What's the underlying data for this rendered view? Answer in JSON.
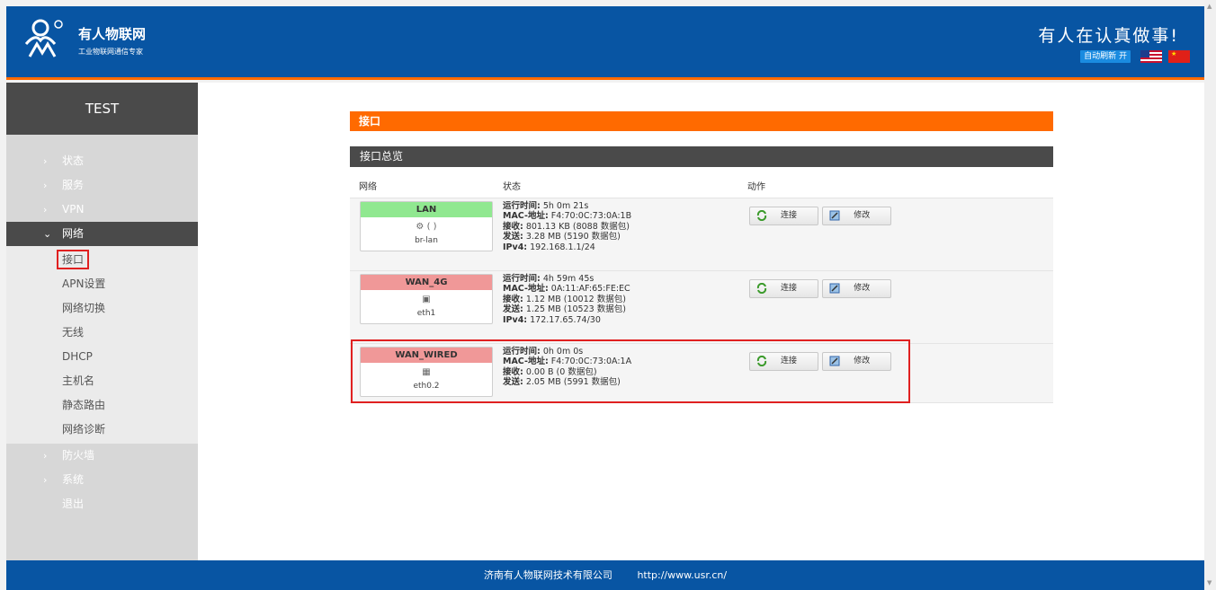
{
  "header": {
    "brand_name": "有人物联网",
    "brand_sub": "工业物联网通信专家",
    "slogan": "有人在认真做事!",
    "auto_refresh": "自动刷新 开",
    "brand_color": "#0855a3",
    "accent_color": "#ff6a00"
  },
  "sidebar": {
    "title": "TEST",
    "items": [
      {
        "label": "状态"
      },
      {
        "label": "服务"
      },
      {
        "label": "VPN"
      },
      {
        "label": "网络"
      },
      {
        "label": "防火墙"
      },
      {
        "label": "系统"
      },
      {
        "label": "退出"
      }
    ],
    "network_sub": [
      {
        "label": "接口"
      },
      {
        "label": "APN设置"
      },
      {
        "label": "网络切换"
      },
      {
        "label": "无线"
      },
      {
        "label": "DHCP"
      },
      {
        "label": "主机名"
      },
      {
        "label": "静态路由"
      },
      {
        "label": "网络诊断"
      }
    ]
  },
  "main": {
    "section_title": "接口",
    "overview_title": "接口总览",
    "columns": {
      "network": "网络",
      "status": "状态",
      "action": "动作"
    },
    "buttons": {
      "connect": "连接",
      "edit": "修改"
    },
    "interfaces": [
      {
        "name": "LAN",
        "state": "up",
        "icon_text": "(  )",
        "device": "br-lan",
        "uptime_label": "运行时间:",
        "uptime": "5h 0m 21s",
        "mac_label": "MAC-地址:",
        "mac": "F4:70:0C:73:0A:1B",
        "rx_label": "接收:",
        "rx": "801.13 KB (8088 数据包)",
        "tx_label": "发送:",
        "tx": "3.28 MB (5190 数据包)",
        "ipv4_label": "IPv4:",
        "ipv4": "192.168.1.1/24"
      },
      {
        "name": "WAN_4G",
        "state": "down",
        "icon_text": "",
        "device": "eth1",
        "uptime_label": "运行时间:",
        "uptime": "4h 59m 45s",
        "mac_label": "MAC-地址:",
        "mac": "0A:11:AF:65:FE:EC",
        "rx_label": "接收:",
        "rx": "1.12 MB (10012 数据包)",
        "tx_label": "发送:",
        "tx": "1.25 MB (10523 数据包)",
        "ipv4_label": "IPv4:",
        "ipv4": "172.17.65.74/30"
      },
      {
        "name": "WAN_WIRED",
        "state": "down",
        "icon_text": "",
        "device": "eth0.2",
        "uptime_label": "运行时间:",
        "uptime": "0h 0m 0s",
        "mac_label": "MAC-地址:",
        "mac": "F4:70:0C:73:0A:1A",
        "rx_label": "接收:",
        "rx": "0.00 B (0 数据包)",
        "tx_label": "发送:",
        "tx": "2.05 MB (5991 数据包)"
      }
    ]
  },
  "footer": {
    "company": "济南有人物联网技术有限公司",
    "url": "http://www.usr.cn/"
  }
}
